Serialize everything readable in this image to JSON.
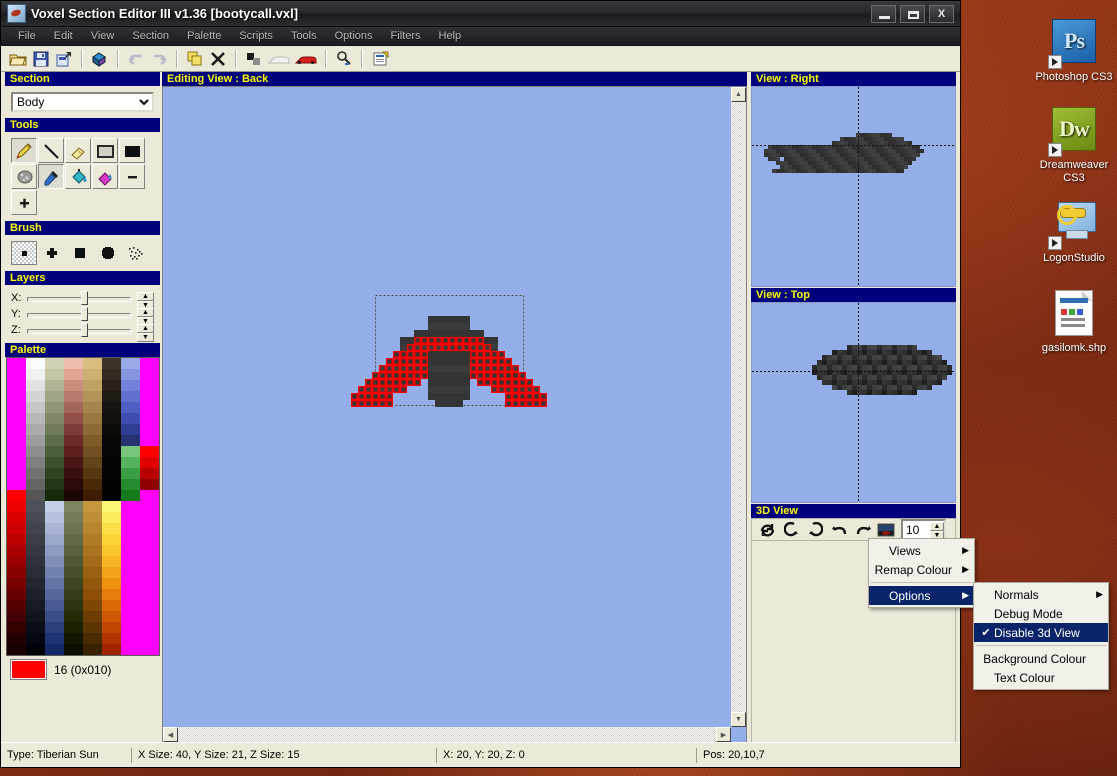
{
  "window": {
    "title": "Voxel Section Editor III v1.36 [bootycall.vxl]",
    "icon": "voxel-app-icon",
    "buttons": {
      "minimize": "minimize-icon",
      "maximize": "maximize-icon",
      "close": "X"
    }
  },
  "menubar": {
    "items": [
      "File",
      "Edit",
      "View",
      "Section",
      "Palette",
      "Scripts",
      "Tools",
      "Options",
      "Filters",
      "Help"
    ]
  },
  "toolbar": {
    "buttons": [
      {
        "name": "open-icon",
        "glyph": "open"
      },
      {
        "name": "save-icon",
        "glyph": "save"
      },
      {
        "name": "save-as-icon",
        "glyph": "saveas"
      },
      {
        "name": "voxel-cube-icon",
        "glyph": "cube"
      },
      {
        "name": "undo-icon",
        "glyph": "undo"
      },
      {
        "name": "redo-icon",
        "glyph": "redo"
      },
      {
        "name": "copy-icon",
        "glyph": "copy"
      },
      {
        "name": "delete-icon",
        "glyph": "x"
      },
      {
        "name": "normals-icon",
        "glyph": "squares"
      },
      {
        "name": "white-car-icon",
        "glyph": "carw"
      },
      {
        "name": "red-car-icon",
        "glyph": "carr"
      },
      {
        "name": "zoom-icon",
        "glyph": "mag"
      },
      {
        "name": "notes-icon",
        "glyph": "notes"
      }
    ]
  },
  "section": {
    "title": "Section",
    "selected": "Body",
    "options": [
      "Body"
    ]
  },
  "tools": {
    "title": "Tools",
    "items": [
      {
        "name": "pencil-tool",
        "glyph": "pencil",
        "selected": true
      },
      {
        "name": "line-tool",
        "glyph": "line",
        "selected": false
      },
      {
        "name": "eraser-tool",
        "glyph": "eraser",
        "selected": false
      },
      {
        "name": "rect-outline-tool",
        "glyph": "rectout",
        "selected": false
      },
      {
        "name": "rect-filled-tool",
        "glyph": "rectfil",
        "selected": false
      },
      {
        "name": "sponge-tool",
        "glyph": "sponge",
        "selected": false
      },
      {
        "name": "eyedropper-tool",
        "glyph": "dropper",
        "selected": true
      },
      {
        "name": "fill-tool",
        "glyph": "fill",
        "selected": false
      },
      {
        "name": "fill-remap-tool",
        "glyph": "fillmag",
        "selected": false
      },
      {
        "name": "decrease-tool",
        "glyph": "minus",
        "selected": false
      },
      {
        "name": "increase-tool",
        "glyph": "plus",
        "selected": false
      }
    ]
  },
  "brush": {
    "title": "Brush",
    "items": [
      {
        "name": "brush-dot",
        "glyph": "dot",
        "selected": true
      },
      {
        "name": "brush-cross",
        "glyph": "cross",
        "selected": false
      },
      {
        "name": "brush-square",
        "glyph": "square",
        "selected": false
      },
      {
        "name": "brush-blob",
        "glyph": "blob",
        "selected": false
      },
      {
        "name": "brush-spray",
        "glyph": "spray",
        "selected": false
      }
    ]
  },
  "layers": {
    "title": "Layers",
    "axes": [
      {
        "label": "X:",
        "pos": 52
      },
      {
        "label": "Y:",
        "pos": 52
      },
      {
        "label": "Z:",
        "pos": 52
      }
    ]
  },
  "palette": {
    "title": "Palette",
    "selected_index": "16",
    "selected_hex_label": "16 (0x010)",
    "selected_swatch": "#ff0000",
    "colors": [
      "#ff00ff",
      "#fcfcfc",
      "#d3d2b4",
      "#f0bcad",
      "#d9bd7e",
      "#3b3326",
      "#9aa9e8",
      "#ff00ff",
      "#ff00ff",
      "#f0f0f0",
      "#c5c4a4",
      "#dfa492",
      "#cdaf71",
      "#312a20",
      "#8795e0",
      "#ff00ff",
      "#ff00ff",
      "#e2e2e2",
      "#b3b395",
      "#c88f7f",
      "#c0a164",
      "#272119",
      "#7382d8",
      "#ff00ff",
      "#ff00ff",
      "#d4d4d4",
      "#a2a486",
      "#b57b6d",
      "#b39358",
      "#1f1a14",
      "#6170cf",
      "#ff00ff",
      "#ff00ff",
      "#c6c6c6",
      "#919677",
      "#a3675a",
      "#a6854c",
      "#17130e",
      "#4f5ec4",
      "#ff00ff",
      "#ff00ff",
      "#b8b8b8",
      "#808868",
      "#924f48",
      "#99773f",
      "#120f0b",
      "#3e4daf",
      "#ff00ff",
      "#ff00ff",
      "#aaaaaa",
      "#6f7a59",
      "#7e3c38",
      "#8c6a35",
      "#0d0b08",
      "#2f3d95",
      "#ff00ff",
      "#ff00ff",
      "#9c9c9c",
      "#5e6c4a",
      "#6c2b28",
      "#7f5d2b",
      "#090705",
      "#27336f",
      "#ff00ff",
      "#ff00ff",
      "#8e8e8e",
      "#4d5e3b",
      "#5b1f1d",
      "#725021",
      "#080604",
      "#76c77b",
      "#ff0000",
      "#ff00ff",
      "#808080",
      "#3c502c",
      "#4a1615",
      "#654318",
      "#070503",
      "#54b35c",
      "#e00000",
      "#ff00ff",
      "#727272",
      "#2e431f",
      "#3a0f0f",
      "#58360f",
      "#060402",
      "#3a9f42",
      "#b80000",
      "#ff00ff",
      "#646464",
      "#213614",
      "#2a0a0a",
      "#4b2907",
      "#050301",
      "#258b2e",
      "#8f0000",
      "#ff0000",
      "#565656",
      "#142a0b",
      "#1c0605",
      "#3e1c04",
      "#040200",
      "#157a1c",
      "#ff00ff",
      "#ee0000",
      "#4c5058",
      "#c6cfe9",
      "#7f8460",
      "#c4973c",
      "#fcf873",
      "#ff00ff",
      "#ff00ff",
      "#dd0000",
      "#464a52",
      "#b8c2e0",
      "#767b57",
      "#bd8e35",
      "#fcec5e",
      "#ff00ff",
      "#ff00ff",
      "#cc0000",
      "#40444c",
      "#aab5d6",
      "#6d724e",
      "#b6852e",
      "#fbe04a",
      "#ff00ff",
      "#ff00ff",
      "#bb0000",
      "#3a3e46",
      "#9ca8cc",
      "#646945",
      "#b07c27",
      "#fbd437",
      "#ff00ff",
      "#ff00ff",
      "#aa0000",
      "#343840",
      "#8e9bc2",
      "#5b603c",
      "#a97320",
      "#f9c62c",
      "#ff00ff",
      "#ff00ff",
      "#990000",
      "#2e323a",
      "#808eb8",
      "#525733",
      "#a26a19",
      "#f7b523",
      "#ff00ff",
      "#ff00ff",
      "#880000",
      "#282c34",
      "#7281ae",
      "#494e2a",
      "#9b6112",
      "#f3a31b",
      "#ff00ff",
      "#ff00ff",
      "#770000",
      "#22262e",
      "#6474a4",
      "#404521",
      "#94580b",
      "#ee9113",
      "#ff00ff",
      "#ff00ff",
      "#660000",
      "#1c2028",
      "#56679a",
      "#373c18",
      "#8d4f05",
      "#e47d0c",
      "#ff00ff",
      "#ff00ff",
      "#550000",
      "#161a22",
      "#485a90",
      "#2e330f",
      "#7e4604",
      "#d96a07",
      "#ff00ff",
      "#ff00ff",
      "#440000",
      "#10141c",
      "#3a4d86",
      "#252a06",
      "#6d3d03",
      "#cc5804",
      "#ff00ff",
      "#ff00ff",
      "#330000",
      "#0a0e16",
      "#2c407c",
      "#1c2100",
      "#5b3402",
      "#bf4602",
      "#ff00ff",
      "#ff00ff",
      "#220000",
      "#040810",
      "#1e3372",
      "#131800",
      "#4a2b01",
      "#b03401",
      "#ff00ff",
      "#ff00ff",
      "#1a0000",
      "#000208",
      "#142a66",
      "#0b1000",
      "#3a2200",
      "#a02400",
      "#ff00ff",
      "#ff00ff"
    ]
  },
  "editing_view": {
    "header": "Editing View : Back",
    "background": "#93aee8"
  },
  "views": {
    "right": {
      "header": "View : Right"
    },
    "top": {
      "header": "View : Top"
    },
    "threed": {
      "header": "3D View"
    }
  },
  "threed_toolbar": {
    "buttons": [
      {
        "name": "rotate-refresh-icon",
        "glyph": "⟳"
      },
      {
        "name": "rotate-left-icon",
        "glyph": "↰"
      },
      {
        "name": "rotate-right-icon",
        "glyph": "↱"
      },
      {
        "name": "turn-left-icon",
        "glyph": "↶"
      },
      {
        "name": "turn-right-icon",
        "glyph": "↷"
      },
      {
        "name": "render-preview-icon",
        "glyph": "thumb"
      }
    ],
    "zoom_value": "10"
  },
  "context_menu": {
    "items": [
      {
        "label": "Views",
        "submenu": true,
        "highlighted": false,
        "checked": false
      },
      {
        "label": "Remap Colour",
        "submenu": true,
        "highlighted": false,
        "checked": false
      },
      {
        "separator": true
      },
      {
        "label": "Options",
        "submenu": true,
        "highlighted": true,
        "checked": false
      }
    ]
  },
  "context_submenu": {
    "items": [
      {
        "label": "Normals",
        "submenu": true,
        "highlighted": false,
        "checked": false
      },
      {
        "label": "Debug Mode",
        "submenu": false,
        "highlighted": false,
        "checked": false
      },
      {
        "label": "Disable 3d View",
        "submenu": false,
        "highlighted": true,
        "checked": true
      },
      {
        "separator": true
      },
      {
        "label": "Background Colour",
        "submenu": false,
        "highlighted": false,
        "checked": false
      },
      {
        "label": "Text Colour",
        "submenu": false,
        "highlighted": false,
        "checked": false
      }
    ]
  },
  "statusbar": {
    "cells": [
      "Type: Tiberian Sun",
      "X Size: 40, Y Size: 21, Z Size: 15",
      "X: 20, Y: 20, Z: 0",
      "Pos: 20,10,7"
    ]
  },
  "desktop": {
    "icons": [
      {
        "name": "photoshop-cs3-icon",
        "label": "Photoshop CS3",
        "type": "ps"
      },
      {
        "name": "dreamweaver-cs3-icon",
        "label": "Dreamweaver CS3",
        "type": "dw"
      },
      {
        "name": "logonstudio-icon",
        "label": "LogonStudio",
        "type": "logon"
      },
      {
        "name": "gasilomk-shp-icon",
        "label": "gasilomk.shp",
        "type": "shp"
      }
    ]
  }
}
